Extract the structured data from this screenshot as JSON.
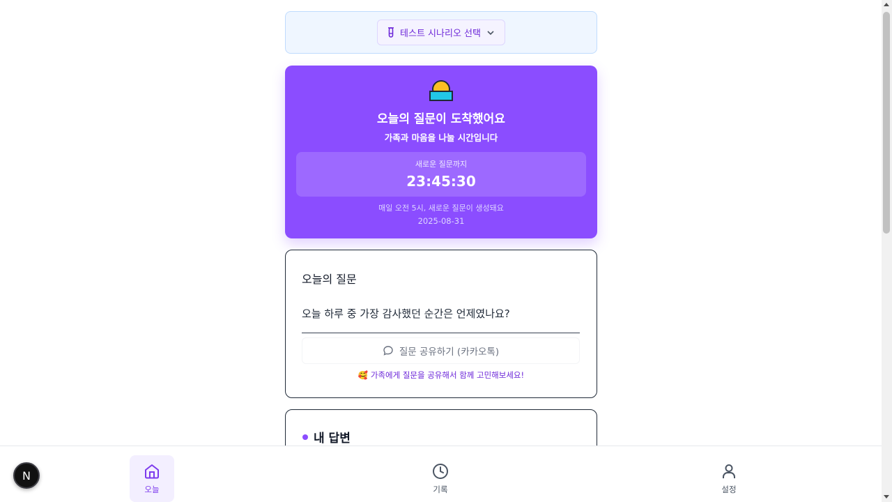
{
  "scenario": {
    "label": "테스트 시나리오 선택"
  },
  "hero": {
    "title": "오늘의 질문이 도착했어요",
    "subtitle": "가족과 마음을 나눌 시간입니다",
    "timer_label": "새로운 질문까지",
    "timer_value": "23:45:30",
    "note": "매일 오전 5시, 새로운 질문이 생성돼요",
    "date": "2025-08-31"
  },
  "question_card": {
    "title": "오늘의 질문",
    "question": "오늘 하루 중 가장 감사했던 순간은 언제였나요?",
    "share_button": "질문 공유하기 (카카오톡)",
    "share_hint": "🥰 가족에게 질문을 공유해서 함께 고민해보세요!"
  },
  "answer_card": {
    "title": "내 답변"
  },
  "nav": {
    "home": "오늘",
    "history": "기록",
    "settings": "설정"
  },
  "badge": {
    "letter": "N"
  },
  "colors": {
    "accent": "#8b4dff",
    "scenario_bg": "#eff6ff"
  }
}
